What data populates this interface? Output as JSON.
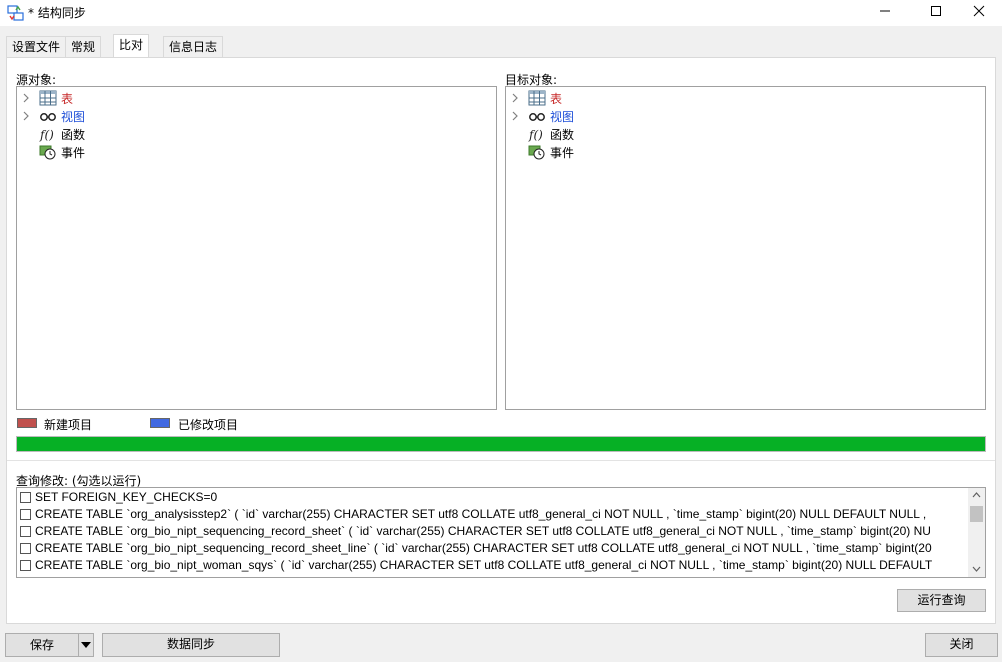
{
  "window": {
    "title": "* 结构同步"
  },
  "tabs": [
    {
      "label": "设置文件"
    },
    {
      "label": "常规"
    },
    {
      "label": "比对"
    },
    {
      "label": "信息日志"
    }
  ],
  "source": {
    "label": "源对象:",
    "items": [
      {
        "label": "表",
        "icon": "table-icon",
        "color": "#c62828"
      },
      {
        "label": "视图",
        "icon": "glasses-icon",
        "color": "#1f4fd8"
      },
      {
        "label": "函数",
        "icon": "function-icon",
        "color": "#000000"
      },
      {
        "label": "事件",
        "icon": "event-clock-icon",
        "color": "#000000"
      }
    ]
  },
  "target": {
    "label": "目标对象:",
    "items": [
      {
        "label": "表",
        "icon": "table-icon",
        "color": "#c62828"
      },
      {
        "label": "视图",
        "icon": "glasses-icon",
        "color": "#1f4fd8"
      },
      {
        "label": "函数",
        "icon": "function-icon",
        "color": "#000000"
      },
      {
        "label": "事件",
        "icon": "event-clock-icon",
        "color": "#000000"
      }
    ]
  },
  "legend": {
    "new_label": "新建项目",
    "new_color": "#c0504d",
    "modified_label": "已修改项目",
    "modified_color": "#4169e1"
  },
  "progress": {
    "value": 1.0,
    "color": "#06b025"
  },
  "queries": {
    "label": "查询修改: (勾选以运行)",
    "rows": [
      "SET FOREIGN_KEY_CHECKS=0",
      "CREATE TABLE `org_analysisstep2` ( `id`  varchar(255) CHARACTER SET utf8 COLLATE utf8_general_ci NOT NULL , `time_stamp`  bigint(20) NULL DEFAULT NULL ,",
      "CREATE TABLE `org_bio_nipt_sequencing_record_sheet` ( `id`  varchar(255) CHARACTER SET utf8 COLLATE utf8_general_ci NOT NULL , `time_stamp`  bigint(20) NU",
      "CREATE TABLE `org_bio_nipt_sequencing_record_sheet_line` ( `id`  varchar(255) CHARACTER SET utf8 COLLATE utf8_general_ci NOT NULL , `time_stamp`  bigint(20",
      "CREATE TABLE `org_bio_nipt_woman_sqys` ( `id`  varchar(255) CHARACTER SET utf8 COLLATE utf8_general_ci NOT NULL , `time_stamp`  bigint(20) NULL DEFAULT"
    ]
  },
  "buttons": {
    "run_query": "运行查询",
    "save": "保存",
    "sync": "数据同步",
    "close": "关闭"
  }
}
